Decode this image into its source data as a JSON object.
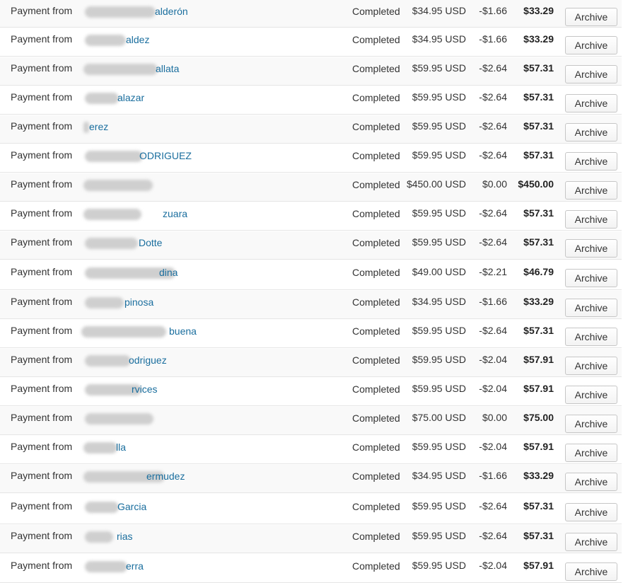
{
  "table": {
    "rows": [
      {
        "type": "Payment from",
        "name_suffix": "alderón",
        "status": "Completed",
        "gross": "$34.95 USD",
        "fee": "-$1.66",
        "net": "$33.29",
        "action": "Archive"
      },
      {
        "type": "Payment from",
        "name_suffix": "aldez",
        "status": "Completed",
        "gross": "$34.95 USD",
        "fee": "-$1.66",
        "net": "$33.29",
        "action": "Archive"
      },
      {
        "type": "Payment from",
        "name_suffix": "allata",
        "status": "Completed",
        "gross": "$59.95 USD",
        "fee": "-$2.64",
        "net": "$57.31",
        "action": "Archive"
      },
      {
        "type": "Payment from",
        "name_suffix": "alazar",
        "status": "Completed",
        "gross": "$59.95 USD",
        "fee": "-$2.64",
        "net": "$57.31",
        "action": "Archive"
      },
      {
        "type": "Payment from",
        "name_suffix": "erez",
        "status": "Completed",
        "gross": "$59.95 USD",
        "fee": "-$2.64",
        "net": "$57.31",
        "action": "Archive"
      },
      {
        "type": "Payment from",
        "name_suffix": "ODRIGUEZ",
        "status": "Completed",
        "gross": "$59.95 USD",
        "fee": "-$2.64",
        "net": "$57.31",
        "action": "Archive"
      },
      {
        "type": "Payment from",
        "name_suffix": "",
        "status": "Completed",
        "gross": "$450.00 USD",
        "fee": "$0.00",
        "net": "$450.00",
        "action": "Archive"
      },
      {
        "type": "Payment from",
        "name_suffix": "zuara",
        "status": "Completed",
        "gross": "$59.95 USD",
        "fee": "-$2.64",
        "net": "$57.31",
        "action": "Archive"
      },
      {
        "type": "Payment from",
        "name_suffix": "Dotte",
        "status": "Completed",
        "gross": "$59.95 USD",
        "fee": "-$2.64",
        "net": "$57.31",
        "action": "Archive"
      },
      {
        "type": "Payment from",
        "name_suffix": "dina",
        "status": "Completed",
        "gross": "$49.00 USD",
        "fee": "-$2.21",
        "net": "$46.79",
        "action": "Archive"
      },
      {
        "type": "Payment from",
        "name_suffix": "pinosa",
        "status": "Completed",
        "gross": "$34.95 USD",
        "fee": "-$1.66",
        "net": "$33.29",
        "action": "Archive"
      },
      {
        "type": "Payment from",
        "name_suffix": "buena",
        "status": "Completed",
        "gross": "$59.95 USD",
        "fee": "-$2.64",
        "net": "$57.31",
        "action": "Archive"
      },
      {
        "type": "Payment from",
        "name_suffix": "odriguez",
        "status": "Completed",
        "gross": "$59.95 USD",
        "fee": "-$2.04",
        "net": "$57.91",
        "action": "Archive"
      },
      {
        "type": "Payment from",
        "name_suffix": "rvices",
        "status": "Completed",
        "gross": "$59.95 USD",
        "fee": "-$2.04",
        "net": "$57.91",
        "action": "Archive"
      },
      {
        "type": "Payment from",
        "name_suffix": "",
        "status": "Completed",
        "gross": "$75.00 USD",
        "fee": "$0.00",
        "net": "$75.00",
        "action": "Archive"
      },
      {
        "type": "Payment from",
        "name_suffix": "lla",
        "status": "Completed",
        "gross": "$59.95 USD",
        "fee": "-$2.04",
        "net": "$57.91",
        "action": "Archive"
      },
      {
        "type": "Payment from",
        "name_suffix": "ermudez",
        "status": "Completed",
        "gross": "$34.95 USD",
        "fee": "-$1.66",
        "net": "$33.29",
        "action": "Archive"
      },
      {
        "type": "Payment from",
        "name_suffix": "Garcia",
        "status": "Completed",
        "gross": "$59.95 USD",
        "fee": "-$2.64",
        "net": "$57.31",
        "action": "Archive"
      },
      {
        "type": "Payment from",
        "name_suffix": "rias",
        "status": "Completed",
        "gross": "$59.95 USD",
        "fee": "-$2.64",
        "net": "$57.31",
        "action": "Archive"
      },
      {
        "type": "Payment from",
        "name_suffix": "erra",
        "status": "Completed",
        "gross": "$59.95 USD",
        "fee": "-$2.04",
        "net": "$57.91",
        "action": "Archive"
      }
    ]
  },
  "colors": {
    "link": "#1a6e9e",
    "row_alt": "#f9f9f9",
    "divider": "#e5e5e5"
  }
}
